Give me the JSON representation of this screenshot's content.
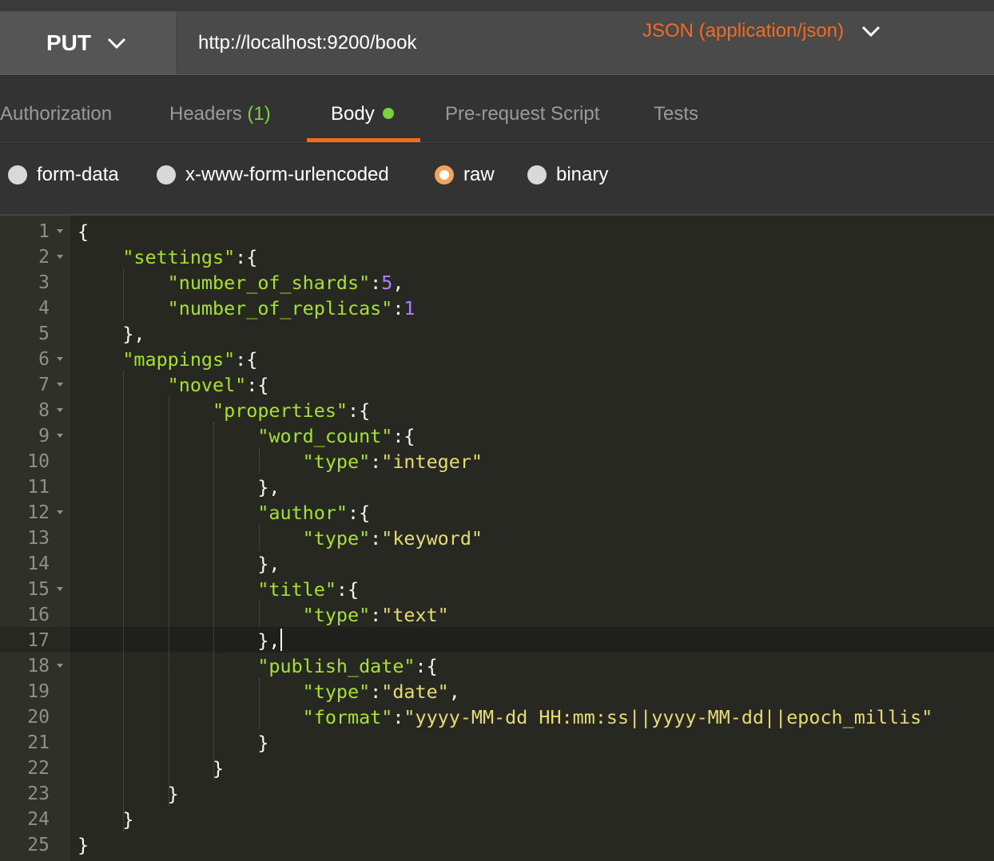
{
  "request": {
    "method": "PUT",
    "url": "http://localhost:9200/book"
  },
  "tabs": [
    {
      "label": "Authorization"
    },
    {
      "label": "Headers",
      "count": "(1)"
    },
    {
      "label": "Body",
      "active": true
    },
    {
      "label": "Pre-request Script"
    },
    {
      "label": "Tests"
    }
  ],
  "body_options": {
    "options": [
      "form-data",
      "x-www-form-urlencoded",
      "raw",
      "binary"
    ],
    "selected": "raw",
    "content_type": "JSON (application/json)"
  },
  "editor": {
    "current_line": 17,
    "lines": [
      {
        "n": "1",
        "fold": true,
        "code": "{"
      },
      {
        "n": "2",
        "fold": true,
        "code": "    \"settings\":{"
      },
      {
        "n": "3",
        "fold": false,
        "code": "        \"number_of_shards\":5,"
      },
      {
        "n": "4",
        "fold": false,
        "code": "        \"number_of_replicas\":1"
      },
      {
        "n": "5",
        "fold": false,
        "code": "    },"
      },
      {
        "n": "6",
        "fold": true,
        "code": "    \"mappings\":{"
      },
      {
        "n": "7",
        "fold": true,
        "code": "        \"novel\":{"
      },
      {
        "n": "8",
        "fold": true,
        "code": "            \"properties\":{"
      },
      {
        "n": "9",
        "fold": true,
        "code": "                \"word_count\":{"
      },
      {
        "n": "10",
        "fold": false,
        "code": "                    \"type\":\"integer\""
      },
      {
        "n": "11",
        "fold": false,
        "code": "                },"
      },
      {
        "n": "12",
        "fold": true,
        "code": "                \"author\":{"
      },
      {
        "n": "13",
        "fold": false,
        "code": "                    \"type\":\"keyword\""
      },
      {
        "n": "14",
        "fold": false,
        "code": "                },"
      },
      {
        "n": "15",
        "fold": true,
        "code": "                \"title\":{"
      },
      {
        "n": "16",
        "fold": false,
        "code": "                    \"type\":\"text\""
      },
      {
        "n": "17",
        "fold": false,
        "code": "                },"
      },
      {
        "n": "18",
        "fold": true,
        "code": "                \"publish_date\":{"
      },
      {
        "n": "19",
        "fold": false,
        "code": "                    \"type\":\"date\","
      },
      {
        "n": "20",
        "fold": false,
        "code": "                    \"format\":\"yyyy-MM-dd HH:mm:ss||yyyy-MM-dd||epoch_millis\""
      },
      {
        "n": "21",
        "fold": false,
        "code": "                }"
      },
      {
        "n": "22",
        "fold": false,
        "code": "            }"
      },
      {
        "n": "23",
        "fold": false,
        "code": "        }"
      },
      {
        "n": "24",
        "fold": false,
        "code": "    }"
      },
      {
        "n": "25",
        "fold": false,
        "code": "}"
      }
    ]
  },
  "colors": {
    "accent": "#f26b21",
    "tab_dot": "#7ad13a",
    "json_key": "#a6e22e",
    "json_string": "#e6db74",
    "json_number": "#ae81ff"
  }
}
